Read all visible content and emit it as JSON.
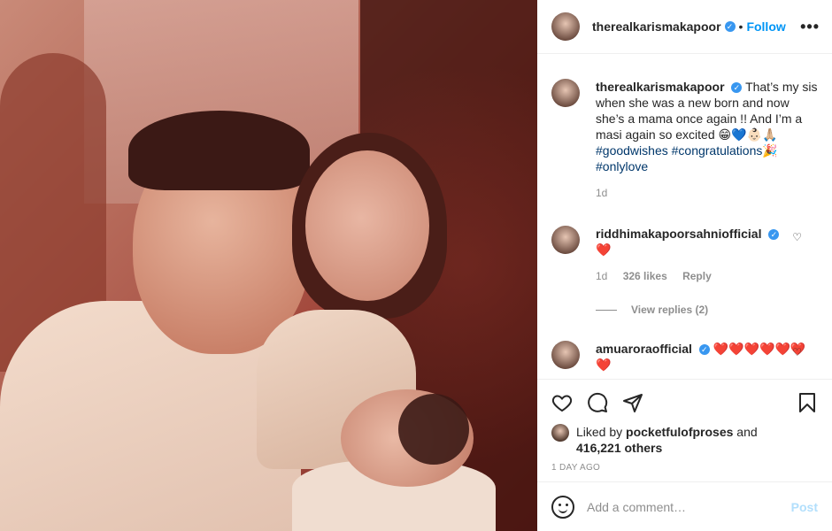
{
  "header": {
    "username": "therealkarismakapoor",
    "dot": "•",
    "follow_label": "Follow",
    "more_label": "•••"
  },
  "caption": {
    "username": "therealkarismakapoor",
    "text": "That’s my sis when she was a new born and now she’s a mama once again !! And I’m a masi again so excited 😁💙👶🏻🙏🏼",
    "hashtags": [
      "#goodwishes",
      "#congratulations🎉",
      "#onlylove"
    ],
    "age": "1d"
  },
  "comments": [
    {
      "username": "riddhimakapoorsahniofficial",
      "text": "❤️",
      "age": "1d",
      "likes": "326 likes",
      "reply_label": "Reply",
      "view_replies": "View replies (2)"
    },
    {
      "username": "amuaroraofficial",
      "text": "❤️❤️❤️❤️❤️❤️❤️"
    }
  ],
  "likes": {
    "prefix": "Liked by",
    "user": "pocketfulofproses",
    "and": "and",
    "count": "416,221 others"
  },
  "posted": "1 DAY AGO",
  "add_comment": {
    "placeholder": "Add a comment…",
    "post_label": "Post"
  },
  "colors": {
    "accent": "#0095f6",
    "post_disabled": "#b2dffc",
    "heart": "#ed4956"
  },
  "icons": [
    "verified-badge-icon",
    "heart-icon",
    "comment-icon",
    "share-icon",
    "bookmark-icon",
    "emoji-icon"
  ]
}
